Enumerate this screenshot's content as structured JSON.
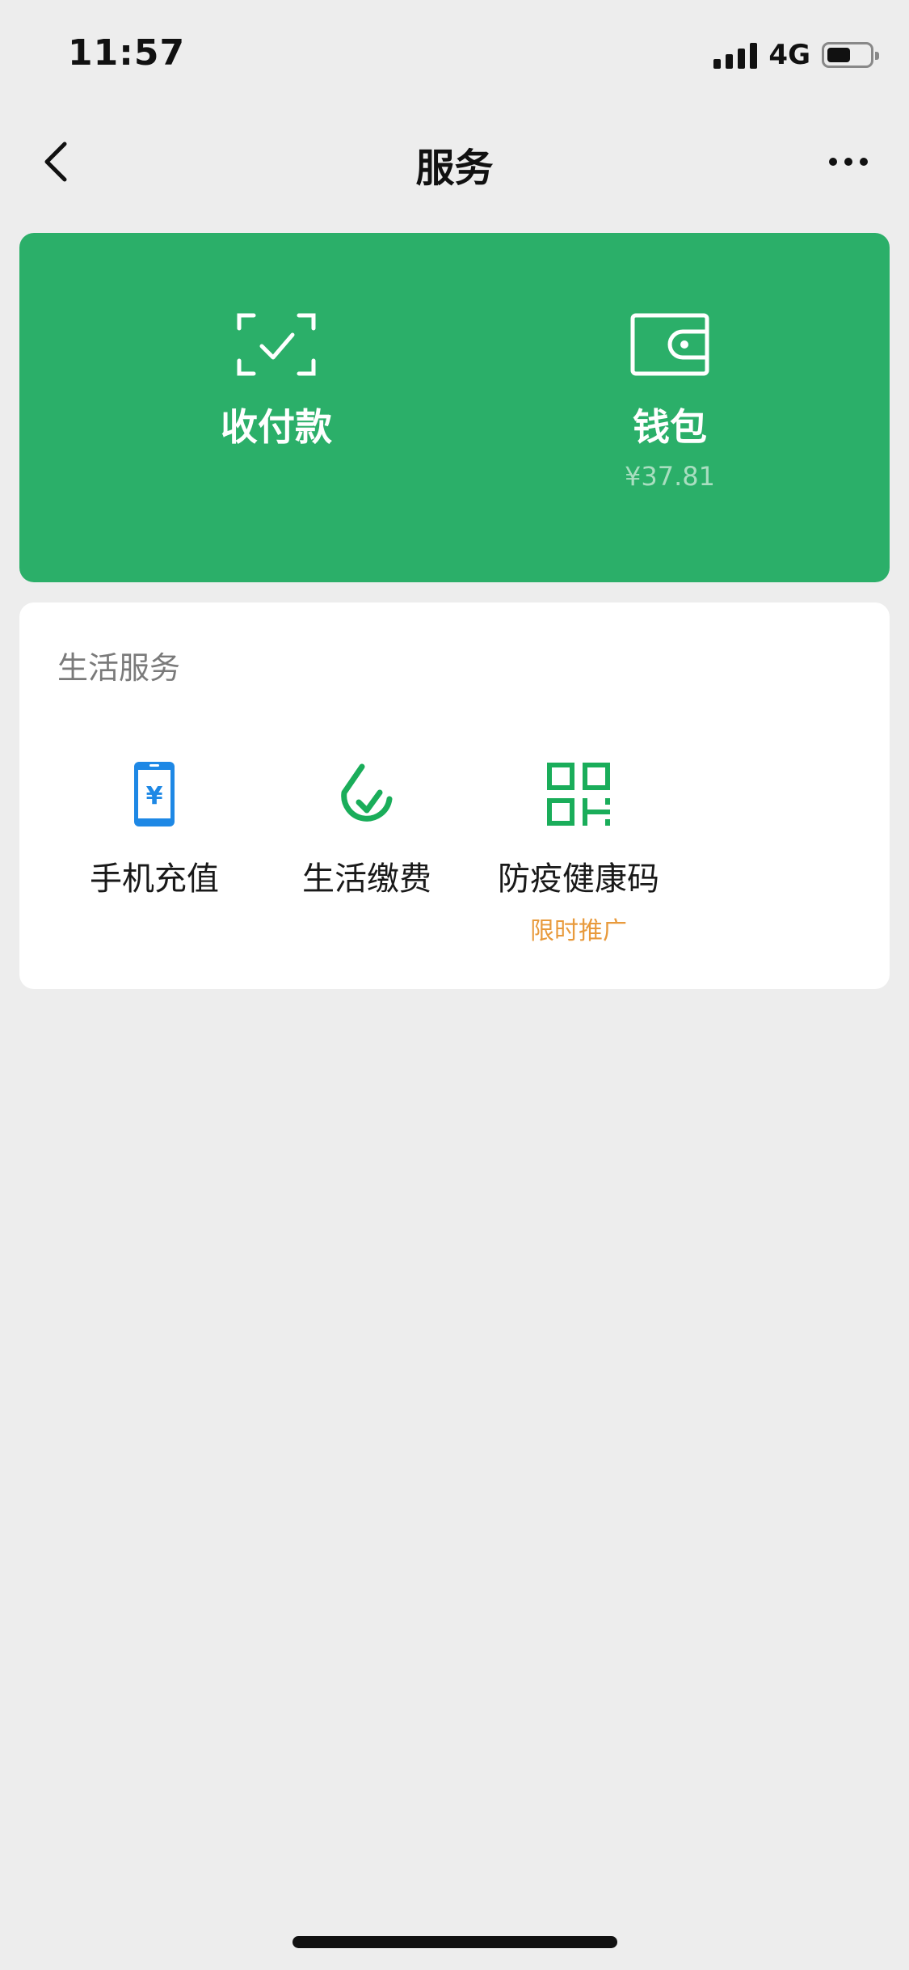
{
  "status_bar": {
    "time": "11:57",
    "network": "4G",
    "signal_bars": 4,
    "battery_level": 0.5
  },
  "nav": {
    "title": "服务",
    "back_icon": "chevron-left-icon",
    "more_icon": "more-horizontal-icon"
  },
  "pay_card": {
    "background_color": "#2BAF69",
    "collect": {
      "label": "收付款",
      "icon": "scan-check-icon"
    },
    "wallet": {
      "label": "钱包",
      "balance": "¥37.81",
      "icon": "wallet-icon"
    }
  },
  "life_services": {
    "title": "生活服务",
    "items": [
      {
        "label": "手机充值",
        "icon": "mobile-topup-icon",
        "icon_color": "#1E88E5"
      },
      {
        "label": "生活缴费",
        "icon": "utility-bill-icon",
        "icon_color": "#1AAD5A"
      },
      {
        "label": "防疫健康码",
        "tag": "限时推广",
        "icon": "qr-code-icon",
        "icon_color": "#1AAD5A"
      }
    ]
  }
}
